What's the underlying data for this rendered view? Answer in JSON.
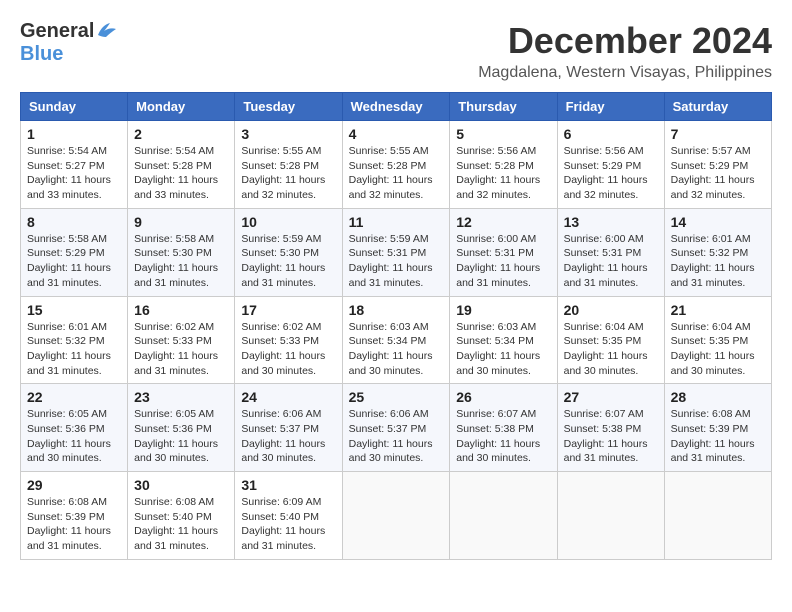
{
  "header": {
    "logo_general": "General",
    "logo_blue": "Blue",
    "month": "December 2024",
    "location": "Magdalena, Western Visayas, Philippines"
  },
  "weekdays": [
    "Sunday",
    "Monday",
    "Tuesday",
    "Wednesday",
    "Thursday",
    "Friday",
    "Saturday"
  ],
  "weeks": [
    [
      {
        "day": "1",
        "info": "Sunrise: 5:54 AM\nSunset: 5:27 PM\nDaylight: 11 hours\nand 33 minutes."
      },
      {
        "day": "2",
        "info": "Sunrise: 5:54 AM\nSunset: 5:28 PM\nDaylight: 11 hours\nand 33 minutes."
      },
      {
        "day": "3",
        "info": "Sunrise: 5:55 AM\nSunset: 5:28 PM\nDaylight: 11 hours\nand 32 minutes."
      },
      {
        "day": "4",
        "info": "Sunrise: 5:55 AM\nSunset: 5:28 PM\nDaylight: 11 hours\nand 32 minutes."
      },
      {
        "day": "5",
        "info": "Sunrise: 5:56 AM\nSunset: 5:28 PM\nDaylight: 11 hours\nand 32 minutes."
      },
      {
        "day": "6",
        "info": "Sunrise: 5:56 AM\nSunset: 5:29 PM\nDaylight: 11 hours\nand 32 minutes."
      },
      {
        "day": "7",
        "info": "Sunrise: 5:57 AM\nSunset: 5:29 PM\nDaylight: 11 hours\nand 32 minutes."
      }
    ],
    [
      {
        "day": "8",
        "info": "Sunrise: 5:58 AM\nSunset: 5:29 PM\nDaylight: 11 hours\nand 31 minutes."
      },
      {
        "day": "9",
        "info": "Sunrise: 5:58 AM\nSunset: 5:30 PM\nDaylight: 11 hours\nand 31 minutes."
      },
      {
        "day": "10",
        "info": "Sunrise: 5:59 AM\nSunset: 5:30 PM\nDaylight: 11 hours\nand 31 minutes."
      },
      {
        "day": "11",
        "info": "Sunrise: 5:59 AM\nSunset: 5:31 PM\nDaylight: 11 hours\nand 31 minutes."
      },
      {
        "day": "12",
        "info": "Sunrise: 6:00 AM\nSunset: 5:31 PM\nDaylight: 11 hours\nand 31 minutes."
      },
      {
        "day": "13",
        "info": "Sunrise: 6:00 AM\nSunset: 5:31 PM\nDaylight: 11 hours\nand 31 minutes."
      },
      {
        "day": "14",
        "info": "Sunrise: 6:01 AM\nSunset: 5:32 PM\nDaylight: 11 hours\nand 31 minutes."
      }
    ],
    [
      {
        "day": "15",
        "info": "Sunrise: 6:01 AM\nSunset: 5:32 PM\nDaylight: 11 hours\nand 31 minutes."
      },
      {
        "day": "16",
        "info": "Sunrise: 6:02 AM\nSunset: 5:33 PM\nDaylight: 11 hours\nand 31 minutes."
      },
      {
        "day": "17",
        "info": "Sunrise: 6:02 AM\nSunset: 5:33 PM\nDaylight: 11 hours\nand 30 minutes."
      },
      {
        "day": "18",
        "info": "Sunrise: 6:03 AM\nSunset: 5:34 PM\nDaylight: 11 hours\nand 30 minutes."
      },
      {
        "day": "19",
        "info": "Sunrise: 6:03 AM\nSunset: 5:34 PM\nDaylight: 11 hours\nand 30 minutes."
      },
      {
        "day": "20",
        "info": "Sunrise: 6:04 AM\nSunset: 5:35 PM\nDaylight: 11 hours\nand 30 minutes."
      },
      {
        "day": "21",
        "info": "Sunrise: 6:04 AM\nSunset: 5:35 PM\nDaylight: 11 hours\nand 30 minutes."
      }
    ],
    [
      {
        "day": "22",
        "info": "Sunrise: 6:05 AM\nSunset: 5:36 PM\nDaylight: 11 hours\nand 30 minutes."
      },
      {
        "day": "23",
        "info": "Sunrise: 6:05 AM\nSunset: 5:36 PM\nDaylight: 11 hours\nand 30 minutes."
      },
      {
        "day": "24",
        "info": "Sunrise: 6:06 AM\nSunset: 5:37 PM\nDaylight: 11 hours\nand 30 minutes."
      },
      {
        "day": "25",
        "info": "Sunrise: 6:06 AM\nSunset: 5:37 PM\nDaylight: 11 hours\nand 30 minutes."
      },
      {
        "day": "26",
        "info": "Sunrise: 6:07 AM\nSunset: 5:38 PM\nDaylight: 11 hours\nand 30 minutes."
      },
      {
        "day": "27",
        "info": "Sunrise: 6:07 AM\nSunset: 5:38 PM\nDaylight: 11 hours\nand 31 minutes."
      },
      {
        "day": "28",
        "info": "Sunrise: 6:08 AM\nSunset: 5:39 PM\nDaylight: 11 hours\nand 31 minutes."
      }
    ],
    [
      {
        "day": "29",
        "info": "Sunrise: 6:08 AM\nSunset: 5:39 PM\nDaylight: 11 hours\nand 31 minutes."
      },
      {
        "day": "30",
        "info": "Sunrise: 6:08 AM\nSunset: 5:40 PM\nDaylight: 11 hours\nand 31 minutes."
      },
      {
        "day": "31",
        "info": "Sunrise: 6:09 AM\nSunset: 5:40 PM\nDaylight: 11 hours\nand 31 minutes."
      },
      null,
      null,
      null,
      null
    ]
  ]
}
